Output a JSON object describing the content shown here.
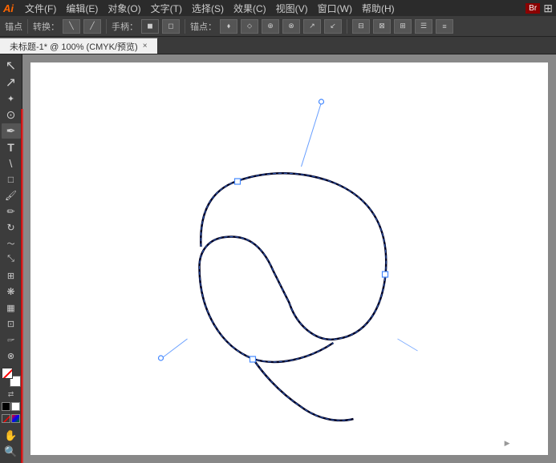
{
  "app": {
    "logo": "Ai",
    "title": "Adobe Illustrator"
  },
  "menubar": {
    "items": [
      "文件(F)",
      "编辑(E)",
      "对象(O)",
      "文字(T)",
      "选择(S)",
      "效果(C)",
      "视图(V)",
      "窗口(W)",
      "帮助(H)"
    ],
    "br_label": "Br"
  },
  "options_bar": {
    "label1": "锚点",
    "label2": "转换：",
    "label3": "手柄：",
    "label4": "锚点：",
    "anchor_icon1": "▲",
    "anchor_icon2": "▲",
    "anchor_icon3": "◆",
    "anchor_icon4": "◆"
  },
  "tab": {
    "title": "未标题-1* @ 100% (CMYK/预览)",
    "close": "×"
  },
  "tools": [
    {
      "name": "selection",
      "icon": "↖",
      "label": "选择工具"
    },
    {
      "name": "direct-selection",
      "icon": "↗",
      "label": "直接选择工具"
    },
    {
      "name": "magic-wand",
      "icon": "✦",
      "label": "魔棒工具"
    },
    {
      "name": "lasso",
      "icon": "⟳",
      "label": "套索工具"
    },
    {
      "name": "pen",
      "icon": "✒",
      "label": "钢笔工具"
    },
    {
      "name": "type",
      "icon": "T",
      "label": "文字工具"
    },
    {
      "name": "line",
      "icon": "╲",
      "label": "直线段工具"
    },
    {
      "name": "rectangle",
      "icon": "□",
      "label": "矩形工具"
    },
    {
      "name": "paintbrush",
      "icon": "🖌",
      "label": "画笔工具"
    },
    {
      "name": "pencil",
      "icon": "✏",
      "label": "铅笔工具"
    },
    {
      "name": "rotate",
      "icon": "↻",
      "label": "旋转工具"
    },
    {
      "name": "reflect",
      "icon": "⇔",
      "label": "镜像工具"
    },
    {
      "name": "scale",
      "icon": "⤡",
      "label": "比例工具"
    },
    {
      "name": "warp",
      "icon": "〜",
      "label": "变形工具"
    },
    {
      "name": "free-transform",
      "icon": "⊞",
      "label": "自由变换"
    },
    {
      "name": "symbol",
      "icon": "❋",
      "label": "符号工具"
    },
    {
      "name": "column-graph",
      "icon": "▦",
      "label": "柱形图工具"
    },
    {
      "name": "artboard",
      "icon": "⊡",
      "label": "画板工具"
    },
    {
      "name": "slice",
      "icon": "⊞",
      "label": "切片工具"
    },
    {
      "name": "hand",
      "icon": "✋",
      "label": "抓手工具"
    },
    {
      "name": "zoom",
      "icon": "🔍",
      "label": "缩放工具"
    }
  ],
  "canvas": {
    "zoom": "100%",
    "color_mode": "CMYK/预览"
  },
  "colors": {
    "accent_red": "#cc3333",
    "toolbar_bg": "#3c3c3c",
    "canvas_bg": "#888888",
    "path_color": "#000033",
    "guide_color": "#4488ff"
  }
}
